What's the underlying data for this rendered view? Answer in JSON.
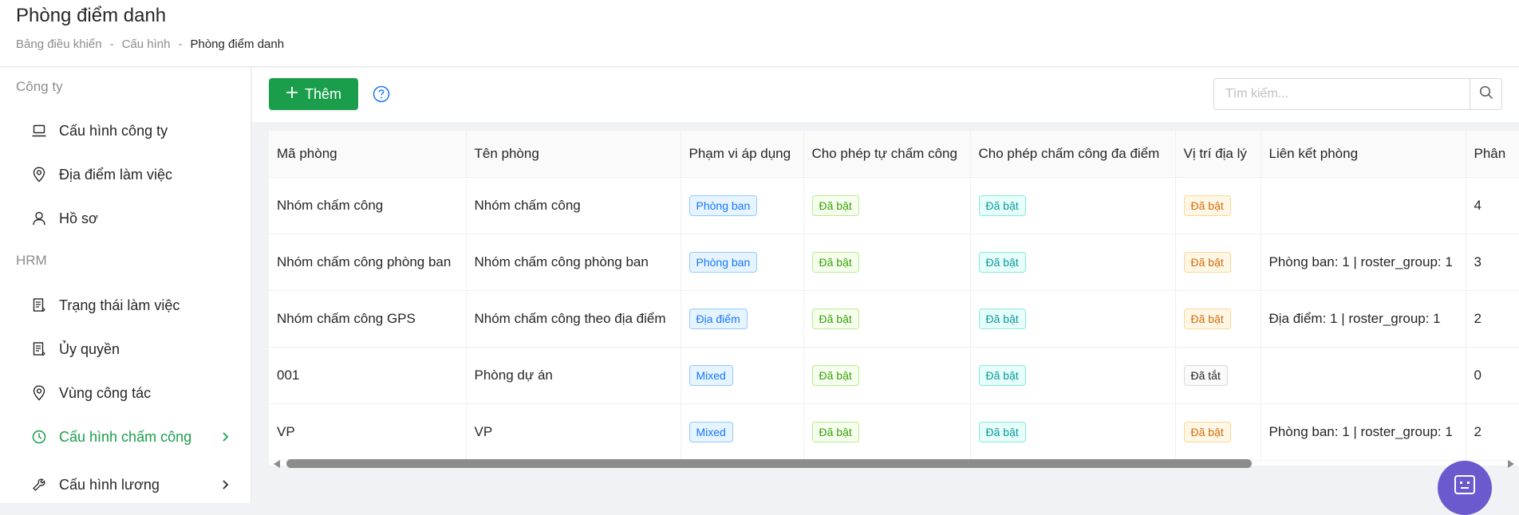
{
  "header": {
    "title": "Phòng điểm danh",
    "breadcrumb": [
      "Bảng điều khiển",
      "-",
      "Cấu hình",
      "-",
      "Phòng điểm danh"
    ]
  },
  "sidebar": {
    "sections": [
      {
        "label": "Công ty"
      },
      {
        "label": "HRM"
      }
    ],
    "items": [
      {
        "label": "Cấu hình công ty",
        "icon": "laptop-icon"
      },
      {
        "label": "Địa điểm làm việc",
        "icon": "location-pin-icon"
      },
      {
        "label": "Hồ sơ",
        "icon": "user-icon"
      },
      {
        "label": "Trạng thái làm việc",
        "icon": "document-icon"
      },
      {
        "label": "Ủy quyền",
        "icon": "document-icon"
      },
      {
        "label": "Vùng công tác",
        "icon": "location-pin-icon"
      },
      {
        "label": "Cấu hình chấm công",
        "icon": "clock-icon",
        "active": true
      },
      {
        "label": "Cấu hình lương",
        "icon": "wrench-icon"
      }
    ],
    "active_color": "#1a9e4b"
  },
  "toolbar": {
    "add_label": "Thêm",
    "search_placeholder": "Tìm kiếm..."
  },
  "table": {
    "columns": [
      "Mã phòng",
      "Tên phòng",
      "Phạm vi áp dụng",
      "Cho phép tự chấm công",
      "Cho phép chấm công đa điểm",
      "Vị trí địa lý",
      "Liên kết phòng",
      "Phân"
    ],
    "rows": [
      [
        "Nhóm chấm công",
        "Nhóm chấm công",
        "Phòng ban",
        "Đã bật",
        "Đã bật",
        "Đã bật",
        "",
        "4"
      ],
      [
        "Nhóm chấm công phòng ban",
        "Nhóm chấm công phòng ban",
        "Phòng ban",
        "Đã bật",
        "Đã bật",
        "Đã bật",
        "Phòng ban: 1 | roster_group: 1",
        "3"
      ],
      [
        "Nhóm chấm công GPS",
        "Nhóm chấm công theo địa điểm",
        "Địa điểm",
        "Đã bật",
        "Đã bật",
        "Đã bật",
        "Địa điểm: 1 | roster_group: 1",
        "2"
      ],
      [
        "001",
        "Phòng dự án",
        "Mixed",
        "Đã bật",
        "Đã bật",
        "Đã tắt",
        "",
        "0"
      ],
      [
        "VP",
        "VP",
        "Mixed",
        "Đã bật",
        "Đã bật",
        "Đã bật",
        "Phòng ban: 1 | roster_group: 1",
        "2"
      ]
    ]
  },
  "colors": {
    "primary": "#1a9e4b",
    "fab": "#6a5acd"
  }
}
